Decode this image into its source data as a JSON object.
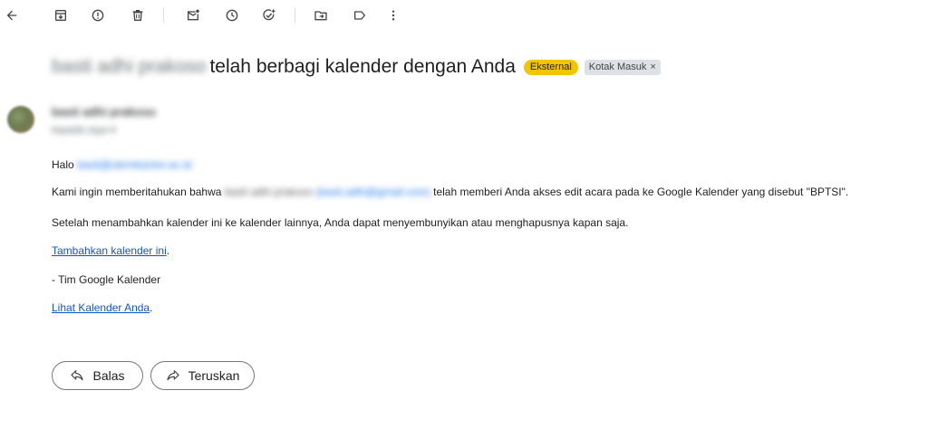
{
  "toolbar": {
    "icons": [
      "back-arrow-icon",
      "archive-icon",
      "report-spam-icon",
      "delete-icon",
      "mark-unread-icon",
      "snooze-icon",
      "add-to-tasks-icon",
      "move-to-icon",
      "label-icon",
      "more-options-icon"
    ]
  },
  "subject": {
    "sender_name": "basti adhi prakoso",
    "text": "telah berbagi kalender dengan Anda",
    "badge_external": "Eksternal",
    "badge_inbox": "Kotak Masuk",
    "badge_inbox_close": "×"
  },
  "sender": {
    "name": "basti adhi prakoso",
    "to": "kepada saya ▾"
  },
  "body": {
    "greeting": "Halo",
    "greeting_email": "basti@ubrmkantor.ac.id",
    "p1_before": "Kami ingin memberitahukan bahwa",
    "p1_blur_name": "basti adhi prakoso",
    "p1_blur_email": "(basti.adhi@gmail.com)",
    "p1_after": "telah memberi Anda akses edit acara pada ke Google Kalender yang disebut \"BPTSI\".",
    "p2": "Setelah menambahkan kalender ini ke kalender lainnya, Anda dapat menyembunyikan atau menghapusnya kapan saja.",
    "add_link": "Tambahkan kalender ini",
    "add_link_period": ".",
    "signature": "- Tim Google Kalender",
    "view_link": "Lihat Kalender Anda",
    "view_link_period": "."
  },
  "actions": {
    "reply_label": "Balas",
    "forward_label": "Teruskan"
  }
}
